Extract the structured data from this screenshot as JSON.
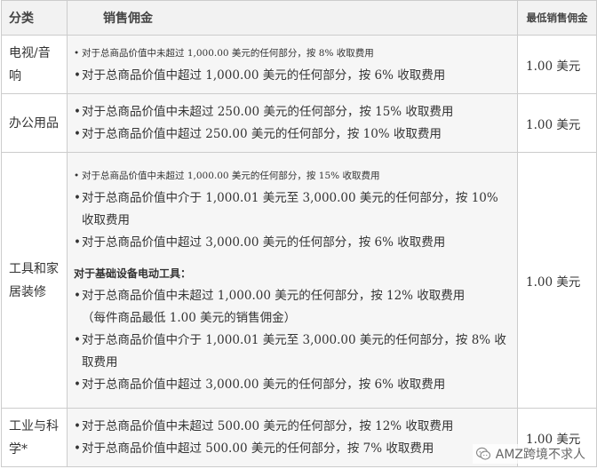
{
  "header": {
    "category": "分类",
    "commission": "销售佣金",
    "min_fee": "最低销售佣金"
  },
  "rows": [
    {
      "category": "电视/音响",
      "bullets": [
        "对于总商品价值中未超过 1,000.00 美元的任何部分，按 8% 收取费用",
        "对于总商品价值中超过 1,000.00 美元的任何部分，按 6% 收取费用"
      ],
      "min_fee": "1.00 美元"
    },
    {
      "category": "办公用品",
      "bullets": [
        "对于总商品价值中未超过 250.00 美元的任何部分，按 15% 收取费用",
        "对于总商品价值中超过 250.00 美元的任何部分，按 10% 收取费用"
      ],
      "min_fee": "1.00 美元"
    },
    {
      "category": "工具和家居装修",
      "bullets": [
        "对于总商品价值中未超过 1,000.00 美元的任何部分，按 15% 收取费用",
        "对于总商品价值中介于 1,000.01 美元至 3,000.00 美元的任何部分，按 10% 收取费用",
        "对于总商品价值中超过 3,000.00 美元的任何部分，按 6% 收取费用"
      ],
      "sub_heading": "对于基础设备电动工具：",
      "sub_bullets": [
        "对于总商品价值中未超过 1,000.00 美元的任何部分，按 12% 收取费用",
        "对于总商品价值中介于 1,000.01 美元至 3,000.00 美元的任何部分，按 8% 收取费用",
        "对于总商品价值中超过 3,000.00 美元的任何部分，按 6% 收取费用"
      ],
      "sub_note": "（每件商品最低 1.00 美元的销售佣金）",
      "min_fee": "1.00 美元"
    },
    {
      "category": "工业与科学*",
      "bullets": [
        "对于总商品价值中未超过 500.00 美元的任何部分，按 12% 收取费用",
        "对于总商品价值中超过 500.00 美元的任何部分，按 7% 收取费用"
      ],
      "min_fee": "1.00 美元"
    }
  ],
  "watermark": {
    "text": "AMZ跨境不求人",
    "icon": "wechat-logo"
  }
}
